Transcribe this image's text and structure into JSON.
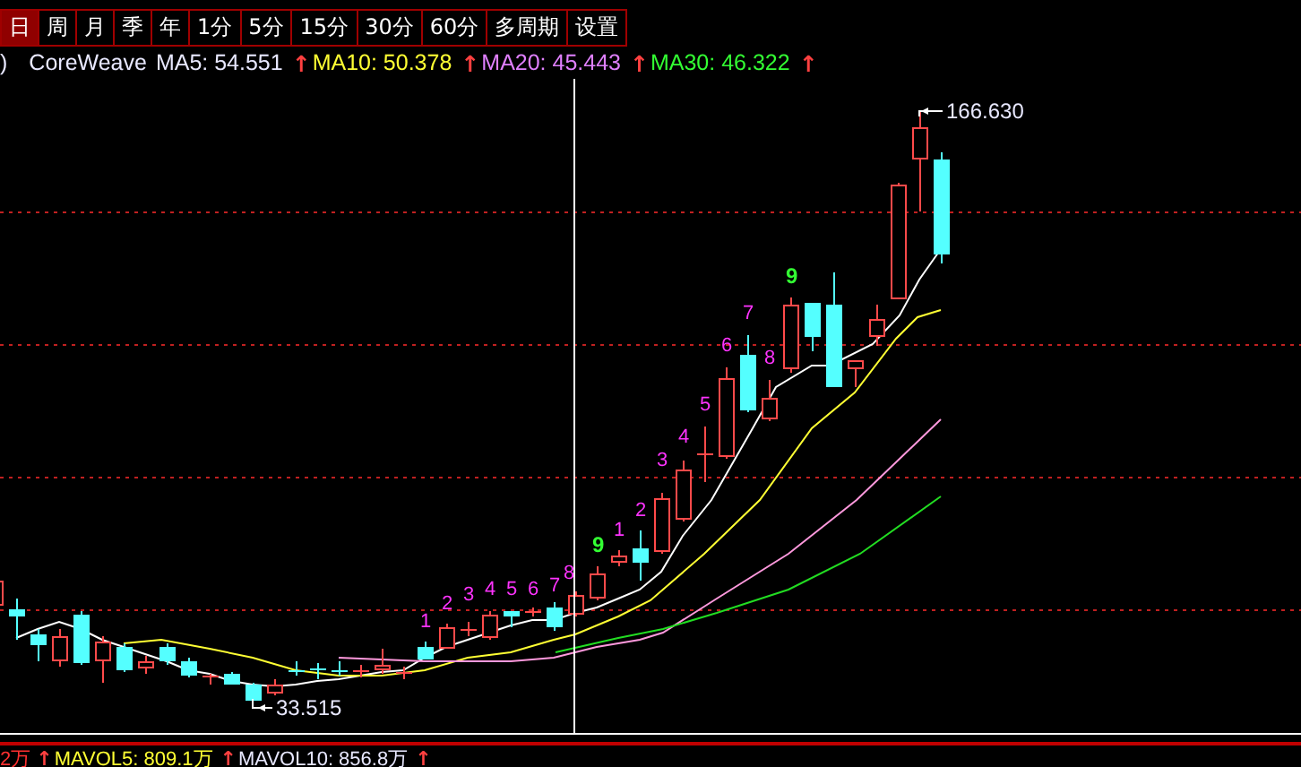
{
  "toolbar": {
    "tabs": [
      {
        "label": "日",
        "selected": true
      },
      {
        "label": "周",
        "selected": false
      },
      {
        "label": "月",
        "selected": false
      },
      {
        "label": "季",
        "selected": false
      },
      {
        "label": "年",
        "selected": false
      },
      {
        "label": "1分",
        "selected": false
      },
      {
        "label": "5分",
        "selected": false
      },
      {
        "label": "15分",
        "selected": false
      },
      {
        "label": "30分",
        "selected": false
      },
      {
        "label": "60分",
        "selected": false
      },
      {
        "label": "多周期",
        "selected": false
      },
      {
        "label": "设置",
        "selected": false
      }
    ]
  },
  "legend": {
    "prefix": ")",
    "symbol": "CoreWeave",
    "averages": [
      {
        "label": "MA5: 54.551",
        "color": "#e8e8ff",
        "arrow": "↑"
      },
      {
        "label": "MA10: 50.378",
        "color": "#ffff33",
        "arrow": "↑"
      },
      {
        "label": "MA20: 45.443",
        "color": "#e080ff",
        "arrow": "↑"
      },
      {
        "label": "MA30: 46.322",
        "color": "#33ff33",
        "arrow": "↑"
      }
    ]
  },
  "chart": {
    "price_labels": [
      {
        "kind": "high",
        "text": "166.630"
      },
      {
        "kind": "low",
        "text": "33.515"
      }
    ],
    "td_counts": [
      {
        "text": "1",
        "color": "#ff33ff"
      },
      {
        "text": "2",
        "color": "#ff33ff"
      },
      {
        "text": "3",
        "color": "#ff33ff"
      },
      {
        "text": "4",
        "color": "#ff33ff"
      },
      {
        "text": "5",
        "color": "#ff33ff"
      },
      {
        "text": "6",
        "color": "#ff33ff"
      },
      {
        "text": "7",
        "color": "#ff33ff"
      },
      {
        "text": "8",
        "color": "#ff33ff"
      },
      {
        "text": "9",
        "color": "#33ff33"
      },
      {
        "text": "1",
        "color": "#ff33ff"
      },
      {
        "text": "2",
        "color": "#ff33ff"
      },
      {
        "text": "3",
        "color": "#ff33ff"
      },
      {
        "text": "4",
        "color": "#ff33ff"
      },
      {
        "text": "5",
        "color": "#ff33ff"
      },
      {
        "text": "6",
        "color": "#ff33ff"
      },
      {
        "text": "7",
        "color": "#ff33ff"
      },
      {
        "text": "8",
        "color": "#ff33ff"
      },
      {
        "text": "9",
        "color": "#33ff33"
      }
    ]
  },
  "volume_legend": {
    "prefix": "2万",
    "arrow": "↑",
    "averages": [
      {
        "label": "MAVOL5: 809.1万",
        "color": "#ffff33",
        "arrow": "↑"
      },
      {
        "label": "MAVOL10: 856.8万",
        "color": "#e8e8ff",
        "arrow": "↑"
      }
    ]
  }
}
